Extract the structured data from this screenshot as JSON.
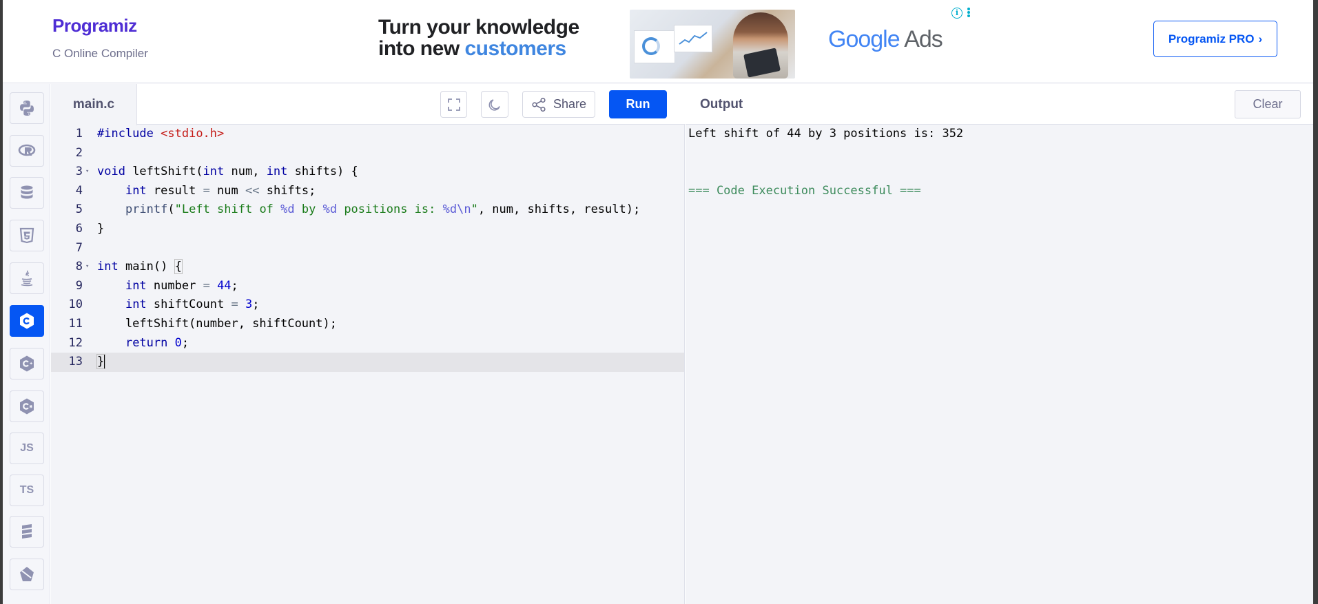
{
  "header": {
    "logo_text": "Programiz",
    "subtitle": "C Online Compiler",
    "pro_button": "Programiz PRO",
    "pro_chevron": "›"
  },
  "ad": {
    "headline_line1": "Turn your knowledge",
    "headline_line2_prefix": "into new ",
    "headline_line2_highlight": "customers",
    "brand_google": "Google",
    "brand_ads": "Ads",
    "info_glyph": "i"
  },
  "sidebar": {
    "items": [
      {
        "name": "python",
        "icon": "python-icon",
        "label": ""
      },
      {
        "name": "r",
        "icon": "r-icon",
        "label": ""
      },
      {
        "name": "sql",
        "icon": "database-icon",
        "label": ""
      },
      {
        "name": "html",
        "icon": "html5-icon",
        "label": ""
      },
      {
        "name": "java",
        "icon": "java-icon",
        "label": ""
      },
      {
        "name": "c",
        "icon": "c-icon",
        "label": "",
        "active": true
      },
      {
        "name": "cpp",
        "icon": "cpp-icon",
        "label": ""
      },
      {
        "name": "csharp",
        "icon": "csharp-icon",
        "label": ""
      },
      {
        "name": "javascript",
        "icon": "js-icon",
        "label": "JS"
      },
      {
        "name": "typescript",
        "icon": "ts-icon",
        "label": "TS"
      },
      {
        "name": "go",
        "icon": "stack-icon",
        "label": ""
      },
      {
        "name": "swift",
        "icon": "swift-icon",
        "label": ""
      }
    ]
  },
  "editor": {
    "file_name": "main.c",
    "share_label": "Share",
    "run_label": "Run",
    "lines": [
      "1",
      "2",
      "3",
      "4",
      "5",
      "6",
      "7",
      "8",
      "9",
      "10",
      "11",
      "12",
      "13"
    ]
  },
  "output": {
    "title": "Output",
    "clear_label": "Clear",
    "line1": "Left shift of 44 by 3 positions is: 352",
    "line2": "=== Code Execution Successful ==="
  },
  "colors": {
    "accent": "#0556f3",
    "editor_bg": "#f3f4f8",
    "success_text": "#3d8b5c"
  }
}
